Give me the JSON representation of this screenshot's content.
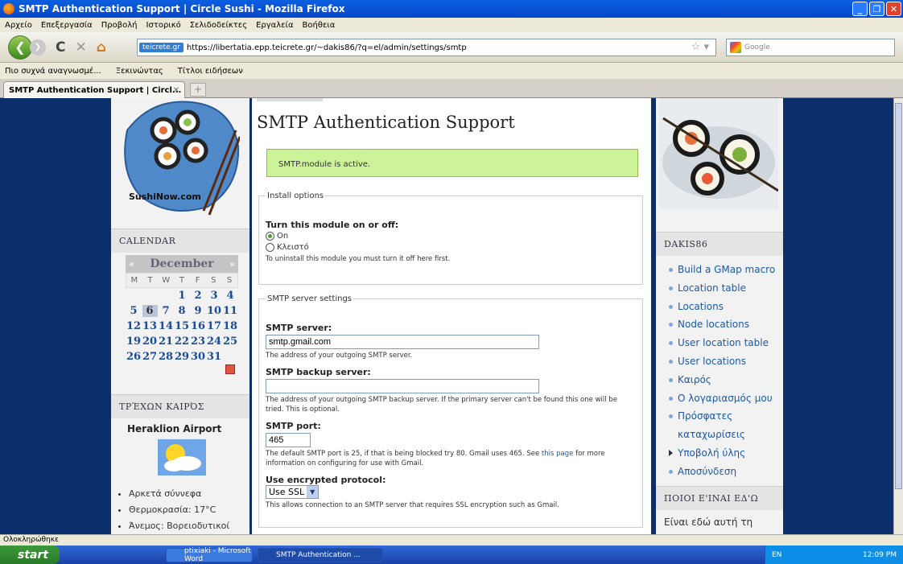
{
  "window": {
    "title": "SMTP Authentication Support | Circle Sushi - Mozilla Firefox"
  },
  "menu": [
    "Αρχείο",
    "Επεξεργασία",
    "Προβολή",
    "Ιστορικό",
    "Σελιδοδείκτες",
    "Εργαλεία",
    "Βοήθεια"
  ],
  "nav": {
    "site_badge": "teicrete.gr",
    "url": "https://libertatia.epp.teicrete.gr/~dakis86/?q=el/admin/settings/smtp",
    "search_placeholder": "Google"
  },
  "bookmarks": [
    "Πιο συχνά αναγνωσμέ...",
    "Ξεκινώντας",
    "Τίτλοι ειδήσεων"
  ],
  "tab": {
    "label": "SMTP Authentication Support | Circl..."
  },
  "left": {
    "logo_text": "SushiNow.com",
    "calendar_title": "CALENDAR",
    "month": "December",
    "prev": "«",
    "next": "»",
    "dow": [
      "M",
      "T",
      "W",
      "T",
      "F",
      "S",
      "S"
    ],
    "weeks": [
      [
        "",
        "",
        "",
        "1",
        "2",
        "3",
        "4"
      ],
      [
        "5",
        "6",
        "7",
        "8",
        "9",
        "10",
        "11"
      ],
      [
        "12",
        "13",
        "14",
        "15",
        "16",
        "17",
        "18"
      ],
      [
        "19",
        "20",
        "21",
        "22",
        "23",
        "24",
        "25"
      ],
      [
        "26",
        "27",
        "28",
        "29",
        "30",
        "31",
        ""
      ]
    ],
    "today": "6",
    "weather_title": "ΤΡΈΧΩΝ ΚΑΙΡΌΣ",
    "weather_location": "Heraklion Airport",
    "weather_items": [
      "Αρκετά σύννεφα",
      "Θερμοκρασία: 17°C",
      "Άνεμος: Βορειοδυτικοί"
    ]
  },
  "main": {
    "title": "SMTP Authentication Support",
    "status": "SMTP.module is active.",
    "install": {
      "legend": "Install options",
      "label": "Turn this module on or off:",
      "opt_on": "On",
      "opt_off": "Κλειστό",
      "desc": "To uninstall this module you must turn it off here first."
    },
    "server": {
      "legend": "SMTP server settings",
      "host_label": "SMTP server:",
      "host_value": "smtp.gmail.com",
      "host_desc": "The address of your outgoing SMTP server.",
      "backup_label": "SMTP backup server:",
      "backup_value": "",
      "backup_desc": "The address of your outgoing SMTP backup server. If the primary server can't be found this one will be tried. This is optional.",
      "port_label": "SMTP port:",
      "port_value": "465",
      "port_desc_a": "The default SMTP port is 25, if that is being blocked try 80. Gmail uses 465. See",
      "port_link": "this page",
      "port_desc_b": "for more information on configuring for use with Gmail.",
      "proto_label": "Use encrypted protocol:",
      "proto_value": "Use SSL",
      "proto_desc": "This allows connection to an SMTP server that requires SSL encryption such as Gmail."
    }
  },
  "right": {
    "user_title": "DAKIS86",
    "links": [
      {
        "label": "Build a GMap macro",
        "marker": "dot"
      },
      {
        "label": "Location table",
        "marker": "dot"
      },
      {
        "label": "Locations",
        "marker": "dot"
      },
      {
        "label": "Node locations",
        "marker": "dot"
      },
      {
        "label": "User location table",
        "marker": "dot"
      },
      {
        "label": "User locations",
        "marker": "dot"
      },
      {
        "label": "Καιρός",
        "marker": "dot"
      },
      {
        "label": "Ο λογαριασμός μου",
        "marker": "dot"
      },
      {
        "label": "Πρόσφατες καταχωρίσεις",
        "marker": "dot"
      },
      {
        "label": "Υποβολή ύλης",
        "marker": "triangle"
      },
      {
        "label": "Αποσύνδεση",
        "marker": "dot"
      }
    ],
    "who_title": "ΠΟΙΟΙ Ε'ΙΝΑΙ ΕΔ'Ω",
    "who_text": "Είναι εδώ αυτή τη"
  },
  "statusbar": "Ολοκληρώθηκε",
  "taskbar": {
    "start": "start",
    "tasks": [
      "ptixiaki - Microsoft Word",
      "SMTP Authentication ..."
    ],
    "lang": "EN",
    "time": "12:09 PM"
  }
}
